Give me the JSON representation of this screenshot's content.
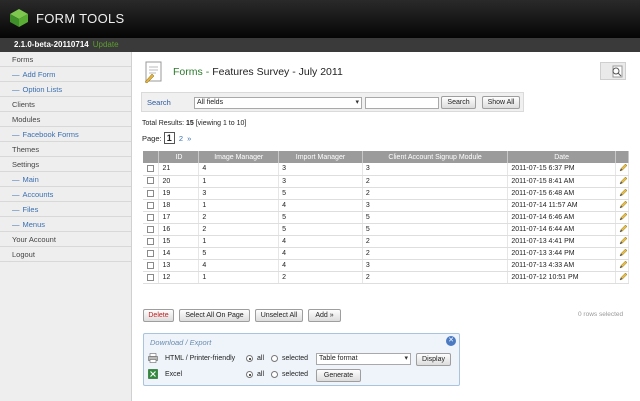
{
  "header": {
    "brand": "FORM TOOLS",
    "version": "2.1.0-beta-20110714",
    "update_label": "Update"
  },
  "sidebar": {
    "items": [
      {
        "label": "Forms",
        "sub": false
      },
      {
        "label": "Add Form",
        "sub": true
      },
      {
        "label": "Option Lists",
        "sub": true
      },
      {
        "label": "Clients",
        "sub": false
      },
      {
        "label": "Modules",
        "sub": false
      },
      {
        "label": "Facebook Forms",
        "sub": true
      },
      {
        "label": "Themes",
        "sub": false
      },
      {
        "label": "Settings",
        "sub": false
      },
      {
        "label": "Main",
        "sub": true
      },
      {
        "label": "Accounts",
        "sub": true
      },
      {
        "label": "Files",
        "sub": true
      },
      {
        "label": "Menus",
        "sub": true
      },
      {
        "label": "Your Account",
        "sub": false
      },
      {
        "label": "Logout",
        "sub": false
      }
    ]
  },
  "page": {
    "forms_link": "Forms",
    "separator": "-",
    "title": "Features Survey - July 2011"
  },
  "search": {
    "label": "Search",
    "field_value": "All fields",
    "input_value": "",
    "search_button": "Search",
    "show_all_button": "Show All"
  },
  "results": {
    "prefix": "Total Results:",
    "count": "15",
    "viewing": "[viewing 1 to 10]"
  },
  "pagination": {
    "label": "Page:",
    "current": "1",
    "next_page": "2",
    "next_arrow": "»"
  },
  "table": {
    "columns": [
      "ID",
      "Image Manager",
      "Import Manager",
      "Client Account Signup Module",
      "Date"
    ],
    "rows": [
      [
        "21",
        "4",
        "3",
        "3",
        "2011-07-15 6:37 PM"
      ],
      [
        "20",
        "1",
        "3",
        "2",
        "2011-07-15 8:41 AM"
      ],
      [
        "19",
        "3",
        "5",
        "2",
        "2011-07-15 6:48 AM"
      ],
      [
        "18",
        "1",
        "4",
        "3",
        "2011-07-14 11:57 AM"
      ],
      [
        "17",
        "2",
        "5",
        "5",
        "2011-07-14 6:46 AM"
      ],
      [
        "16",
        "2",
        "5",
        "5",
        "2011-07-14 6:44 AM"
      ],
      [
        "15",
        "1",
        "4",
        "2",
        "2011-07-13 4:41 PM"
      ],
      [
        "14",
        "5",
        "4",
        "2",
        "2011-07-13 3:44 PM"
      ],
      [
        "13",
        "4",
        "4",
        "3",
        "2011-07-13 4:33 AM"
      ],
      [
        "12",
        "1",
        "2",
        "2",
        "2011-07-12 10:51 PM"
      ]
    ]
  },
  "actions": {
    "delete": "Delete",
    "select_all": "Select All On Page",
    "unselect_all": "Unselect All",
    "add": "Add »",
    "rows_selected": "0 rows selected"
  },
  "export": {
    "title": "Download / Export",
    "html_label": "HTML / Printer-friendly",
    "excel_label": "Excel",
    "all_label": "all",
    "selected_label": "selected",
    "format_value": "Table format",
    "display_button": "Display",
    "generate_button": "Generate"
  },
  "colors": {
    "header_bg": "#111111",
    "accent_green": "#2b7a2b",
    "link_blue": "#3a6fb0",
    "table_header": "#9b9b9b"
  }
}
